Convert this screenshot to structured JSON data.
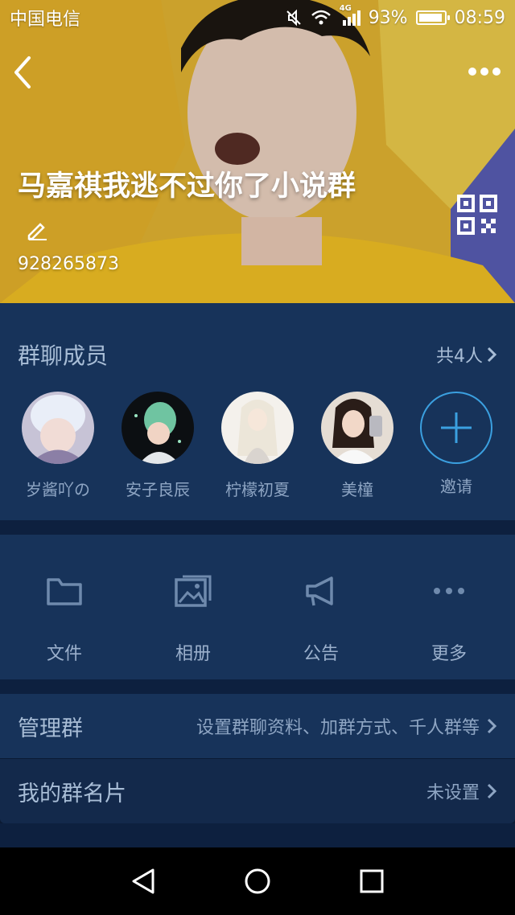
{
  "status": {
    "carrier": "中国电信",
    "network": "4G",
    "battery_percent": "93%",
    "battery_level": 0.93,
    "time": "08:59"
  },
  "header": {
    "title": "马嘉祺我逃不过你了小说群",
    "group_id": "928265873"
  },
  "members": {
    "section_title": "群聊成员",
    "count_label": "共4人",
    "list": [
      {
        "name": "岁酱吖の"
      },
      {
        "name": "安子良辰"
      },
      {
        "name": "柠檬初夏"
      },
      {
        "name": "美橦"
      }
    ],
    "invite_label": "邀请"
  },
  "actions": [
    {
      "label": "文件",
      "icon": "folder-icon"
    },
    {
      "label": "相册",
      "icon": "album-icon"
    },
    {
      "label": "公告",
      "icon": "announcement-icon"
    },
    {
      "label": "更多",
      "icon": "more-dots-icon"
    }
  ],
  "settings": {
    "manage_label": "管理群",
    "manage_desc": "设置群聊资料、加群方式、千人群等",
    "card_label": "我的群名片",
    "card_value": "未设置"
  },
  "colors": {
    "panel": "#17335a",
    "divider": "#0d203f",
    "accent": "#3ba0e0",
    "muted_text": "#8ea5c3"
  }
}
